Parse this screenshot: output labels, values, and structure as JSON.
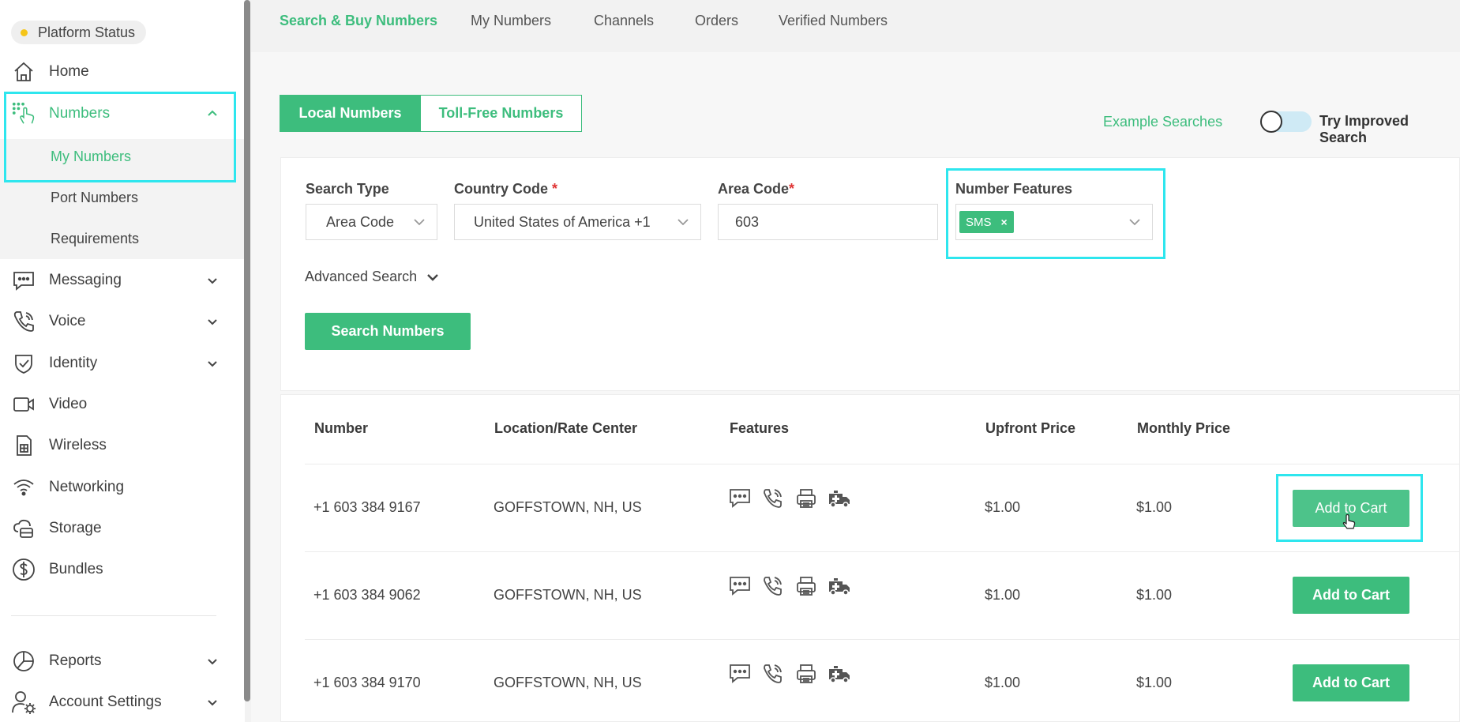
{
  "sidebar": {
    "status_label": "Platform Status",
    "items": {
      "home": "Home",
      "numbers": "Numbers",
      "messaging": "Messaging",
      "voice": "Voice",
      "identity": "Identity",
      "video": "Video",
      "wireless": "Wireless",
      "networking": "Networking",
      "storage": "Storage",
      "bundles": "Bundles",
      "reports": "Reports",
      "account_settings": "Account Settings"
    },
    "numbers_sub": {
      "my_numbers": "My Numbers",
      "port_numbers": "Port Numbers",
      "requirements": "Requirements"
    }
  },
  "top_tabs": {
    "search_buy": "Search & Buy Numbers",
    "my_numbers": "My Numbers",
    "channels": "Channels",
    "orders": "Orders",
    "verified": "Verified Numbers"
  },
  "segments": {
    "local": "Local Numbers",
    "toll_free": "Toll-Free Numbers"
  },
  "example_searches": "Example Searches",
  "improved_search": "Try Improved Search",
  "search": {
    "search_type_label": "Search Type",
    "search_type_value": "Area Code",
    "country_code_label": "Country Code",
    "country_code_value": "United States of America +1",
    "area_code_label": "Area Code",
    "area_code_value": "603",
    "features_label": "Number Features",
    "feature_chip": "SMS",
    "chip_remove": "×",
    "required_mark": "*",
    "advanced": "Advanced Search",
    "button": "Search Numbers"
  },
  "table": {
    "headers": {
      "number": "Number",
      "location": "Location/Rate Center",
      "features": "Features",
      "upfront": "Upfront Price",
      "monthly": "Monthly Price"
    },
    "action_label": "Add to Cart",
    "rows": [
      {
        "number": "+1 603 384 9167",
        "location": "GOFFSTOWN, NH, US",
        "upfront": "$1.00",
        "monthly": "$1.00"
      },
      {
        "number": "+1 603 384 9062",
        "location": "GOFFSTOWN, NH, US",
        "upfront": "$1.00",
        "monthly": "$1.00"
      },
      {
        "number": "+1 603 384 9170",
        "location": "GOFFSTOWN, NH, US",
        "upfront": "$1.00",
        "monthly": "$1.00"
      }
    ],
    "feature_icons": [
      "sms-icon",
      "voice-icon",
      "fax-icon",
      "emergency-icon"
    ]
  },
  "colors": {
    "accent": "#3dbd7d",
    "highlight": "#2ee6ee",
    "status_dot": "#f5c518"
  }
}
